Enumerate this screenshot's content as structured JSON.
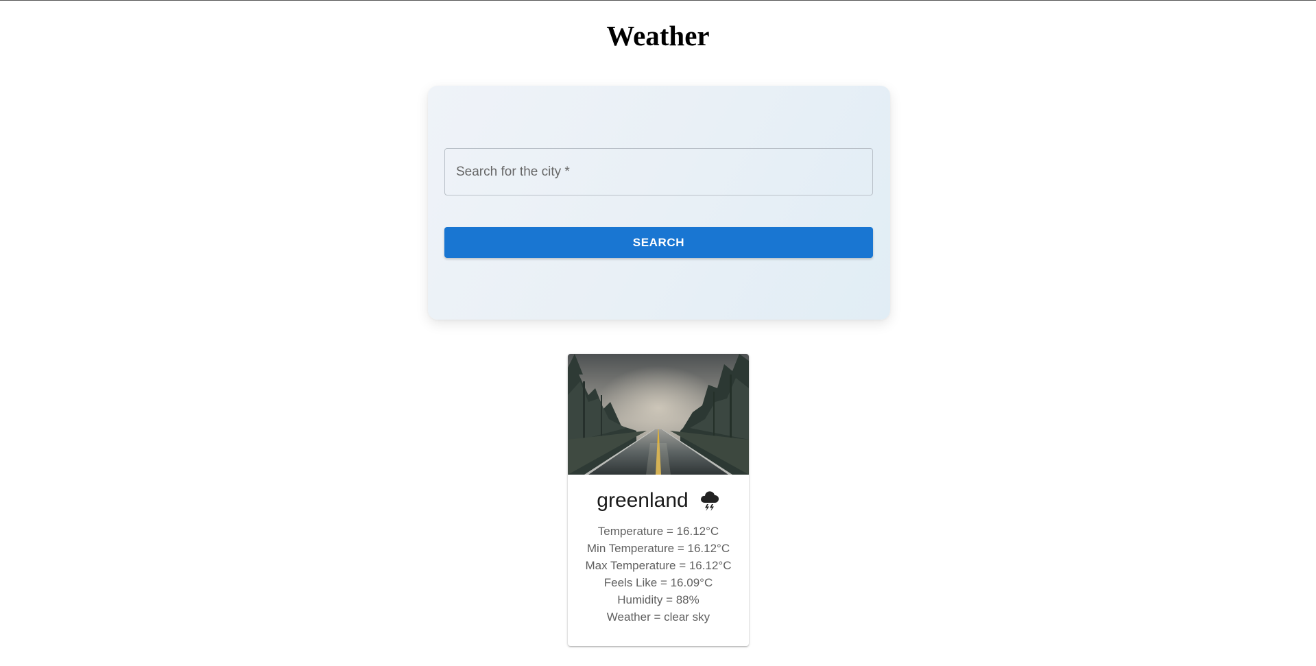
{
  "page": {
    "title": "Weather"
  },
  "search": {
    "placeholder": "Search for the city *",
    "value": "",
    "button_label": "SEARCH"
  },
  "result": {
    "city": "greenland",
    "icon": "thunderstorm-cloud-icon",
    "image": "rainy-forest-road-photo",
    "details": [
      "Temperature = 16.12°C",
      "Min Temperature = 16.12°C",
      "Max Temperature = 16.12°C",
      "Feels Like = 16.09°C",
      "Humidity = 88%",
      "Weather = clear sky"
    ]
  },
  "colors": {
    "accent": "#1976d2",
    "card_gradient_start": "#eff3f8",
    "card_gradient_end": "#e1edf5",
    "detail_text": "#5f5f5f"
  }
}
